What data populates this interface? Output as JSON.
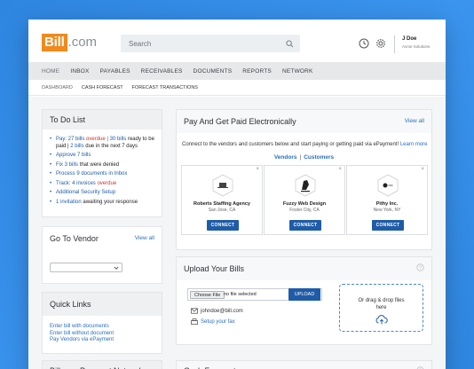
{
  "brand": {
    "logo_box": "Bill",
    "logo_rest": ".com",
    "accent": "#f08a1c"
  },
  "search": {
    "placeholder": "Search"
  },
  "user": {
    "name": "J Doe",
    "company": "Acme Solutions"
  },
  "nav": {
    "items": [
      "HOME",
      "INBOX",
      "PAYABLES",
      "RECEIVABLES",
      "DOCUMENTS",
      "REPORTS",
      "NETWORK"
    ]
  },
  "subnav": {
    "items": [
      "DASHBOARD",
      "CASH FORECAST",
      "FORECAST TRANSACTIONS"
    ]
  },
  "todo": {
    "title": "To Do List",
    "items": [
      {
        "a": "Pay: 27 bills ",
        "b": "overdue",
        "c": " | 30 bills",
        "d": " ready to be paid | ",
        "e": "2 bills",
        "f": " due in the next 7 days"
      },
      {
        "text": "Approve 7 bills"
      },
      {
        "a": "Fix 3 bills",
        "b": " that were denied"
      },
      {
        "text": "Process 9 documents in Inbox"
      },
      {
        "a": "Track: 4 invoices ",
        "b": "overdue"
      },
      {
        "text": "Additional Security Setup"
      },
      {
        "a": "1 invitation",
        "b": " awaiting your response"
      }
    ]
  },
  "goto_vendor": {
    "title": "Go To Vendor",
    "view_all": "View all"
  },
  "quick_links": {
    "title": "Quick Links",
    "links": [
      "Enter bill with documents",
      "Enter bill without document",
      "Pay Vendors via ePayment"
    ]
  },
  "network": {
    "title": "Bill.com Payment Network"
  },
  "pay_and_get": {
    "title": "Pay And Get Paid Electronically",
    "view_all": "View all",
    "desc": "Connect to the vendors and customers below and start paying or getting paid via ePayment! ",
    "learn_more": "Learn more",
    "tab_vendors": "Vendors",
    "tab_sep": "|",
    "tab_customers": "Customers",
    "vendors": [
      {
        "name": "Roberts Staffing Agency",
        "location": "San Jose, CA",
        "button": "CONNECT"
      },
      {
        "name": "Fuzzy Web Design",
        "location": "Foster City, CA",
        "button": "CONNECT"
      },
      {
        "name": "Pithy Inc.",
        "location": "New York, NY",
        "button": "CONNECT"
      }
    ]
  },
  "upload": {
    "title": "Upload Your Bills",
    "choose_file": "Choose File",
    "file_status": "no file selected",
    "upload_btn": "UPLOAD",
    "email": "johndoe@bill.com",
    "fax": "Setup your fax",
    "drop_text_1": "Or drag & drop files",
    "drop_text_2": "here"
  },
  "cash_forecast": {
    "title": "Cash Forecast"
  }
}
